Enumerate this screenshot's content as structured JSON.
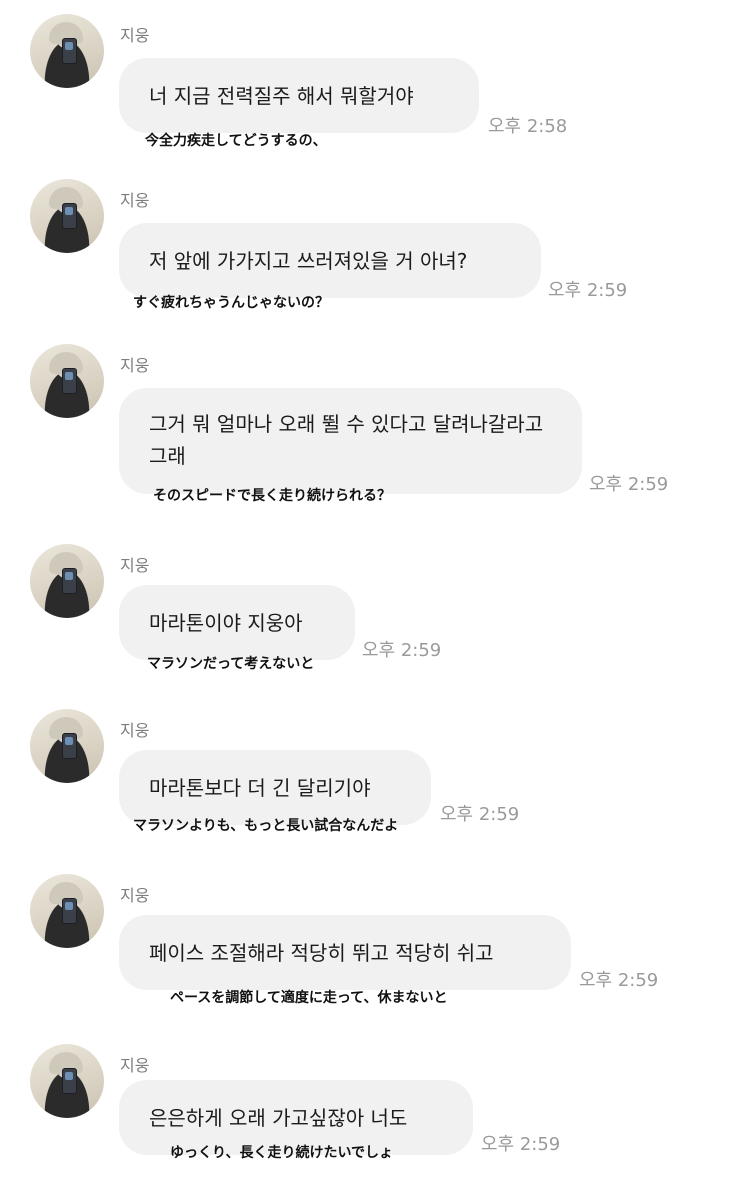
{
  "messages": [
    {
      "sender": "지웅",
      "text": "너 지금 전력질주 해서 뭐할거야",
      "time": "오후 2:58",
      "translation": "今全力疾走してどうするの、"
    },
    {
      "sender": "지웅",
      "text": "저 앞에 가가지고 쓰러져있을 거 아녀?",
      "time": "오후 2:59",
      "translation": "すぐ疲れちゃうんじゃないの？"
    },
    {
      "sender": "지웅",
      "text": "그거 뭐 얼마나 오래 뛸 수 있다고 달려나갈라고 그래",
      "time": "오후 2:59",
      "translation": "そのスピードで長く走り続けられる？"
    },
    {
      "sender": "지웅",
      "text": "마라톤이야 지웅아",
      "time": "오후 2:59",
      "translation": "マラソンだって考えないと"
    },
    {
      "sender": "지웅",
      "text": "마라톤보다 더 긴 달리기야",
      "time": "오후 2:59",
      "translation": "マラソンよりも、もっと長い試合なんだよ"
    },
    {
      "sender": "지웅",
      "text": "페이스 조절해라 적당히 뛰고 적당히 쉬고",
      "time": "오후 2:59",
      "translation": "ペースを調節して適度に走って、休まないと"
    },
    {
      "sender": "지웅",
      "text": "은은하게 오래 가고싶잖아 너도",
      "time": "오후 2:59",
      "translation": "ゆっくり、長く走り続けたいでしょ"
    }
  ],
  "colors": {
    "bubble": "#f1f1f2",
    "time": "#9a9a9a",
    "name": "#7d7d7d",
    "background": "#ffffff"
  }
}
